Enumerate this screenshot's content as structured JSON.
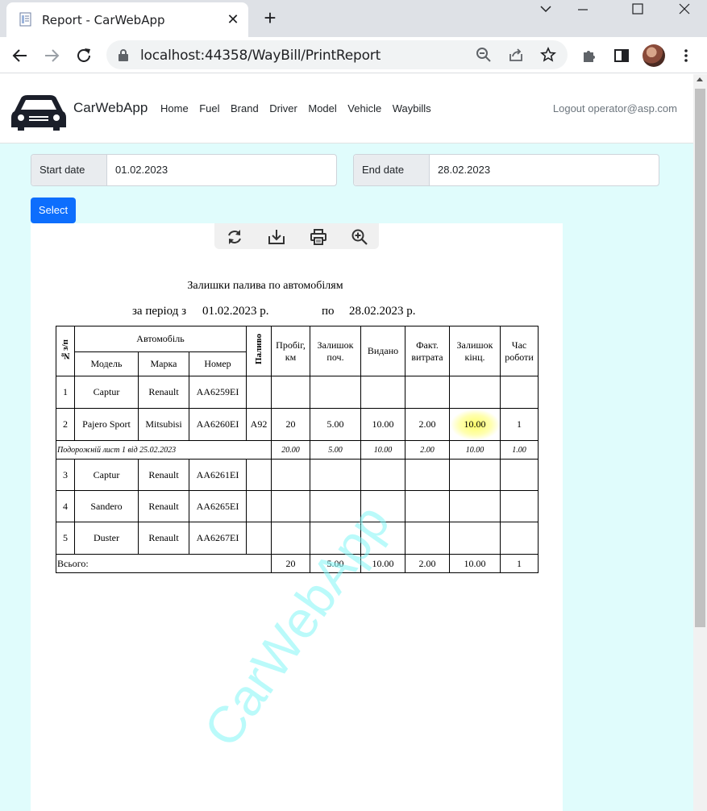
{
  "browser": {
    "tab_title": "Report - CarWebApp",
    "url": "localhost:44358/WayBill/PrintReport"
  },
  "navbar": {
    "brand": "CarWebApp",
    "links": [
      "Home",
      "Fuel",
      "Brand",
      "Driver",
      "Model",
      "Vehicle",
      "Waybills"
    ],
    "logout": "Logout operator@asp.com"
  },
  "filters": {
    "start_label": "Start date",
    "start_value": "01.02.2023",
    "end_label": "End date",
    "end_value": "28.02.2023",
    "select_label": "Select"
  },
  "report": {
    "title": "Залишки палива по автомобілям",
    "period_prefix": "за період з",
    "period_from": "01.02.2023 р.",
    "period_mid": "по",
    "period_to": "28.02.2023 р.",
    "headers": {
      "num": "№з/п",
      "vehicle": "Автомобіль",
      "model": "Модель",
      "brand": "Марка",
      "plate": "Номер",
      "fuel": "Паливо",
      "mileage": "Пробіг, км",
      "start_balance": "Залишок поч.",
      "issued": "Видано",
      "actual": "Факт. витрата",
      "end_balance": "Залишок кінц.",
      "hours": "Час роботи"
    },
    "rows": [
      {
        "num": "1",
        "model": "Captur",
        "brand": "Renault",
        "plate": "AA6259EI",
        "fuel": "",
        "mileage": "",
        "start": "",
        "issued": "",
        "actual": "",
        "end": "",
        "hours": ""
      },
      {
        "num": "2",
        "model": "Pajero Sport",
        "brand": "Mitsubisi",
        "plate": "AA6260EI",
        "fuel": "A92",
        "mileage": "20",
        "start": "5.00",
        "issued": "10.00",
        "actual": "2.00",
        "end": "10.00",
        "hours": "1"
      },
      {
        "num": "3",
        "model": "Captur",
        "brand": "Renault",
        "plate": "AA6261EI",
        "fuel": "",
        "mileage": "",
        "start": "",
        "issued": "",
        "actual": "",
        "end": "",
        "hours": ""
      },
      {
        "num": "4",
        "model": "Sandero",
        "brand": "Renault",
        "plate": "AA6265EI",
        "fuel": "",
        "mileage": "",
        "start": "",
        "issued": "",
        "actual": "",
        "end": "",
        "hours": ""
      },
      {
        "num": "5",
        "model": "Duster",
        "brand": "Renault",
        "plate": "AA6267EI",
        "fuel": "",
        "mileage": "",
        "start": "",
        "issued": "",
        "actual": "",
        "end": "",
        "hours": ""
      }
    ],
    "waybill_row": {
      "label": "Подорожній лист 1 від 25.02.2023",
      "mileage": "20.00",
      "start": "5.00",
      "issued": "10.00",
      "actual": "2.00",
      "end": "10.00",
      "hours": "1.00"
    },
    "totals": {
      "label": "Всього:",
      "mileage": "20",
      "start": "5.00",
      "issued": "10.00",
      "actual": "2.00",
      "end": "10.00",
      "hours": "1"
    },
    "watermark": "CarWebApp"
  },
  "colors": {
    "page_bg": "#e0fcfc",
    "primary": "#0d6efd",
    "highlight": "#ffff66"
  }
}
